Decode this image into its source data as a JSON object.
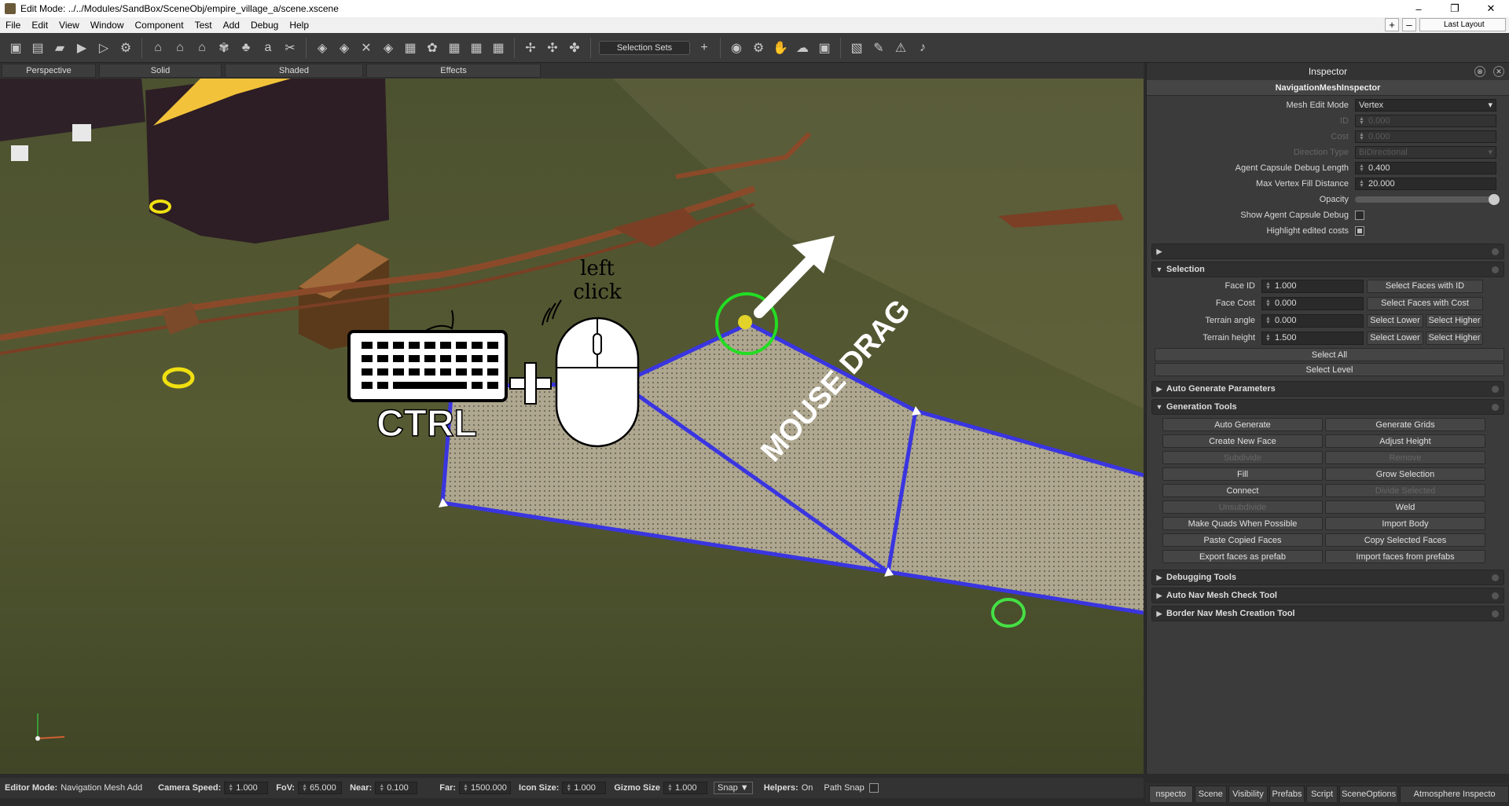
{
  "window": {
    "title": "Edit Mode: ../../Modules/SandBox/SceneObj/empire_village_a/scene.xscene",
    "minimize": "–",
    "maximize": "❐",
    "close": "✕"
  },
  "menu": {
    "items": [
      "File",
      "Edit",
      "View",
      "Window",
      "Component",
      "Test",
      "Add",
      "Debug",
      "Help"
    ],
    "plus": "+",
    "minus": "–",
    "layout": "Last Layout"
  },
  "toolbar": {
    "selection_sets": "Selection Sets",
    "add": "+"
  },
  "view_tabs": [
    "Perspective",
    "Solid",
    "Shaded",
    "Effects"
  ],
  "overlay": {
    "key_label": "CTRL",
    "click_line1": "left",
    "click_line2": "click",
    "drag_label": "MOUSE DRAG"
  },
  "inspector": {
    "title": "Inspector",
    "subtitle": "NavigationMeshInspector",
    "mesh_edit_mode_label": "Mesh Edit Mode",
    "mesh_edit_mode_value": "Vertex",
    "id_label": "ID",
    "id_value": "0.000",
    "cost_label": "Cost",
    "cost_value": "0.000",
    "direction_label": "Direction Type",
    "direction_value": "BiDirectional",
    "agent_capsule_label": "Agent Capsule Debug Length",
    "agent_capsule_value": "0.400",
    "max_vertex_label": "Max Vertex Fill Distance",
    "max_vertex_value": "20.000",
    "opacity_label": "Opacity",
    "opacity_level": 1.0,
    "show_capsule_label": "Show Agent Capsule Debug",
    "highlight_costs_label": "Highlight edited costs"
  },
  "selection": {
    "title": "Selection",
    "face_id_label": "Face ID",
    "face_id_value": "1.000",
    "face_id_btn": "Select Faces with ID",
    "face_cost_label": "Face Cost",
    "face_cost_value": "0.000",
    "face_cost_btn": "Select Faces with Cost",
    "terrain_angle_label": "Terrain angle",
    "terrain_angle_value": "0.000",
    "terrain_height_label": "Terrain height",
    "terrain_height_value": "1.500",
    "select_lower": "Select Lower",
    "select_higher": "Select Higher",
    "select_all": "Select All",
    "select_level": "Select Level"
  },
  "sections": {
    "auto_generate": "Auto Generate Parameters",
    "generation_tools": "Generation Tools",
    "debugging_tools": "Debugging Tools",
    "auto_nav_check": "Auto Nav Mesh Check Tool",
    "border_nav": "Border Nav Mesh Creation Tool"
  },
  "generation_buttons": [
    "Auto Generate",
    "Generate Grids",
    "Create New Face",
    "Adjust Height",
    "Subdivide",
    "Remove",
    "Fill",
    "Grow Selection",
    "Connect",
    "Divide Selected",
    "Unsubdivide",
    "Weld",
    "Make Quads When Possible",
    "Import Body",
    "Paste Copied Faces",
    "Copy Selected Faces",
    "Export faces as prefab",
    "Import faces from prefabs"
  ],
  "status": {
    "editor_mode_label": "Editor Mode:",
    "editor_mode_value": "Navigation Mesh Add",
    "camera_speed_label": "Camera Speed:",
    "camera_speed_value": "1.000",
    "fov_label": "FoV:",
    "fov_value": "65.000",
    "near_label": "Near:",
    "near_value": "0.100",
    "far_label": "Far:",
    "far_value": "1500.000",
    "icon_size_label": "Icon Size:",
    "icon_size_value": "1.000",
    "gizmo_size_label": "Gizmo Size",
    "gizmo_size_value": "1.000",
    "snap": "Snap ▼",
    "helpers_label": "Helpers:",
    "helpers_value": "On",
    "path_snap_label": "Path Snap"
  },
  "bottom_tabs": [
    "nspecto",
    "Scene",
    "Visibility",
    "Prefabs",
    "Script",
    "SceneOptions",
    "Atmosphere Inspecto"
  ]
}
